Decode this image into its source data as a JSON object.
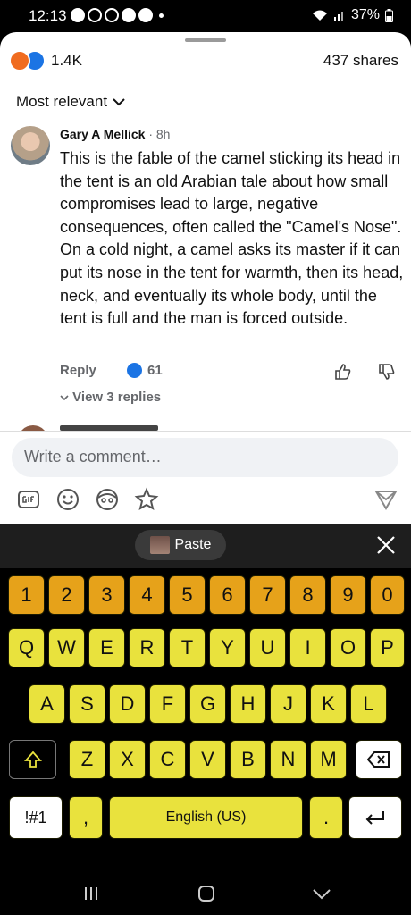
{
  "status_bar": {
    "time": "12:13",
    "battery": "37%"
  },
  "post_stats": {
    "reaction_count": "1.4K",
    "shares": "437 shares"
  },
  "sort": {
    "label": "Most relevant"
  },
  "comment": {
    "author": "Gary A Mellick",
    "time": "· 8h",
    "text": "This is the fable of the camel sticking its head in the tent is an old Arabian tale about how small compromises lead to large, negative consequences, often called the \"Camel's Nose\". On a cold night, a camel asks its master if it can put its nose in the tent for warmth, then its head, neck, and eventually its whole body, until the tent is full and the man is forced outside.",
    "reply_label": "Reply",
    "like_count": "61",
    "view_replies": "View 3 replies"
  },
  "composer": {
    "placeholder": "Write a comment…"
  },
  "keyboard": {
    "paste_label": "Paste",
    "number_row": [
      "1",
      "2",
      "3",
      "4",
      "5",
      "6",
      "7",
      "8",
      "9",
      "0"
    ],
    "row1": [
      "Q",
      "W",
      "E",
      "R",
      "T",
      "Y",
      "U",
      "I",
      "O",
      "P"
    ],
    "row2": [
      "A",
      "S",
      "D",
      "F",
      "G",
      "H",
      "J",
      "K",
      "L"
    ],
    "row3": [
      "Z",
      "X",
      "C",
      "V",
      "B",
      "N",
      "M"
    ],
    "symbols_label": "!#1",
    "comma_label": ",",
    "space_label": "English (US)",
    "period_label": "."
  },
  "colors": {
    "accent": "#1b74e4",
    "key_yellow": "#e9e23d",
    "key_orange": "#e6a21a"
  }
}
